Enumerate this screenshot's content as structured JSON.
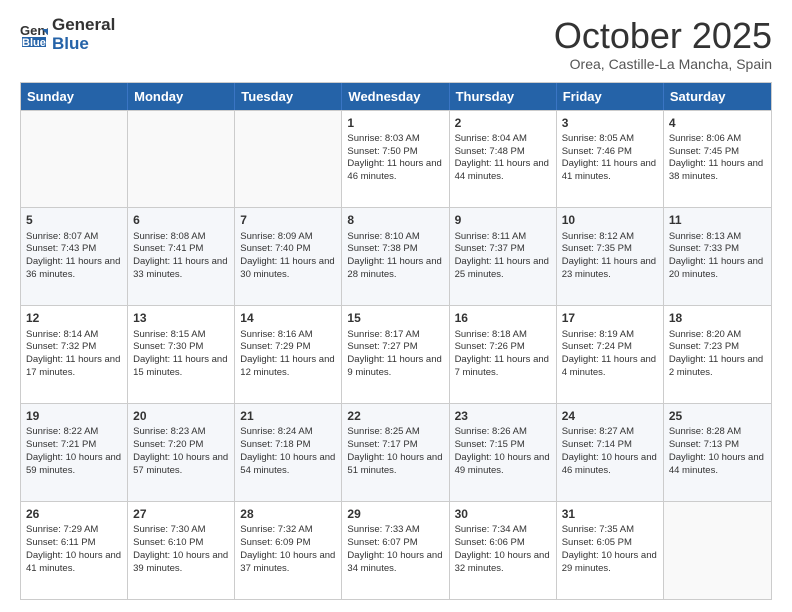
{
  "logo": {
    "line1": "General",
    "line2": "Blue"
  },
  "header": {
    "month": "October 2025",
    "location": "Orea, Castille-La Mancha, Spain"
  },
  "weekdays": [
    "Sunday",
    "Monday",
    "Tuesday",
    "Wednesday",
    "Thursday",
    "Friday",
    "Saturday"
  ],
  "rows": [
    [
      {
        "day": "",
        "text": ""
      },
      {
        "day": "",
        "text": ""
      },
      {
        "day": "",
        "text": ""
      },
      {
        "day": "1",
        "text": "Sunrise: 8:03 AM\nSunset: 7:50 PM\nDaylight: 11 hours and 46 minutes."
      },
      {
        "day": "2",
        "text": "Sunrise: 8:04 AM\nSunset: 7:48 PM\nDaylight: 11 hours and 44 minutes."
      },
      {
        "day": "3",
        "text": "Sunrise: 8:05 AM\nSunset: 7:46 PM\nDaylight: 11 hours and 41 minutes."
      },
      {
        "day": "4",
        "text": "Sunrise: 8:06 AM\nSunset: 7:45 PM\nDaylight: 11 hours and 38 minutes."
      }
    ],
    [
      {
        "day": "5",
        "text": "Sunrise: 8:07 AM\nSunset: 7:43 PM\nDaylight: 11 hours and 36 minutes."
      },
      {
        "day": "6",
        "text": "Sunrise: 8:08 AM\nSunset: 7:41 PM\nDaylight: 11 hours and 33 minutes."
      },
      {
        "day": "7",
        "text": "Sunrise: 8:09 AM\nSunset: 7:40 PM\nDaylight: 11 hours and 30 minutes."
      },
      {
        "day": "8",
        "text": "Sunrise: 8:10 AM\nSunset: 7:38 PM\nDaylight: 11 hours and 28 minutes."
      },
      {
        "day": "9",
        "text": "Sunrise: 8:11 AM\nSunset: 7:37 PM\nDaylight: 11 hours and 25 minutes."
      },
      {
        "day": "10",
        "text": "Sunrise: 8:12 AM\nSunset: 7:35 PM\nDaylight: 11 hours and 23 minutes."
      },
      {
        "day": "11",
        "text": "Sunrise: 8:13 AM\nSunset: 7:33 PM\nDaylight: 11 hours and 20 minutes."
      }
    ],
    [
      {
        "day": "12",
        "text": "Sunrise: 8:14 AM\nSunset: 7:32 PM\nDaylight: 11 hours and 17 minutes."
      },
      {
        "day": "13",
        "text": "Sunrise: 8:15 AM\nSunset: 7:30 PM\nDaylight: 11 hours and 15 minutes."
      },
      {
        "day": "14",
        "text": "Sunrise: 8:16 AM\nSunset: 7:29 PM\nDaylight: 11 hours and 12 minutes."
      },
      {
        "day": "15",
        "text": "Sunrise: 8:17 AM\nSunset: 7:27 PM\nDaylight: 11 hours and 9 minutes."
      },
      {
        "day": "16",
        "text": "Sunrise: 8:18 AM\nSunset: 7:26 PM\nDaylight: 11 hours and 7 minutes."
      },
      {
        "day": "17",
        "text": "Sunrise: 8:19 AM\nSunset: 7:24 PM\nDaylight: 11 hours and 4 minutes."
      },
      {
        "day": "18",
        "text": "Sunrise: 8:20 AM\nSunset: 7:23 PM\nDaylight: 11 hours and 2 minutes."
      }
    ],
    [
      {
        "day": "19",
        "text": "Sunrise: 8:22 AM\nSunset: 7:21 PM\nDaylight: 10 hours and 59 minutes."
      },
      {
        "day": "20",
        "text": "Sunrise: 8:23 AM\nSunset: 7:20 PM\nDaylight: 10 hours and 57 minutes."
      },
      {
        "day": "21",
        "text": "Sunrise: 8:24 AM\nSunset: 7:18 PM\nDaylight: 10 hours and 54 minutes."
      },
      {
        "day": "22",
        "text": "Sunrise: 8:25 AM\nSunset: 7:17 PM\nDaylight: 10 hours and 51 minutes."
      },
      {
        "day": "23",
        "text": "Sunrise: 8:26 AM\nSunset: 7:15 PM\nDaylight: 10 hours and 49 minutes."
      },
      {
        "day": "24",
        "text": "Sunrise: 8:27 AM\nSunset: 7:14 PM\nDaylight: 10 hours and 46 minutes."
      },
      {
        "day": "25",
        "text": "Sunrise: 8:28 AM\nSunset: 7:13 PM\nDaylight: 10 hours and 44 minutes."
      }
    ],
    [
      {
        "day": "26",
        "text": "Sunrise: 7:29 AM\nSunset: 6:11 PM\nDaylight: 10 hours and 41 minutes."
      },
      {
        "day": "27",
        "text": "Sunrise: 7:30 AM\nSunset: 6:10 PM\nDaylight: 10 hours and 39 minutes."
      },
      {
        "day": "28",
        "text": "Sunrise: 7:32 AM\nSunset: 6:09 PM\nDaylight: 10 hours and 37 minutes."
      },
      {
        "day": "29",
        "text": "Sunrise: 7:33 AM\nSunset: 6:07 PM\nDaylight: 10 hours and 34 minutes."
      },
      {
        "day": "30",
        "text": "Sunrise: 7:34 AM\nSunset: 6:06 PM\nDaylight: 10 hours and 32 minutes."
      },
      {
        "day": "31",
        "text": "Sunrise: 7:35 AM\nSunset: 6:05 PM\nDaylight: 10 hours and 29 minutes."
      },
      {
        "day": "",
        "text": ""
      }
    ]
  ]
}
